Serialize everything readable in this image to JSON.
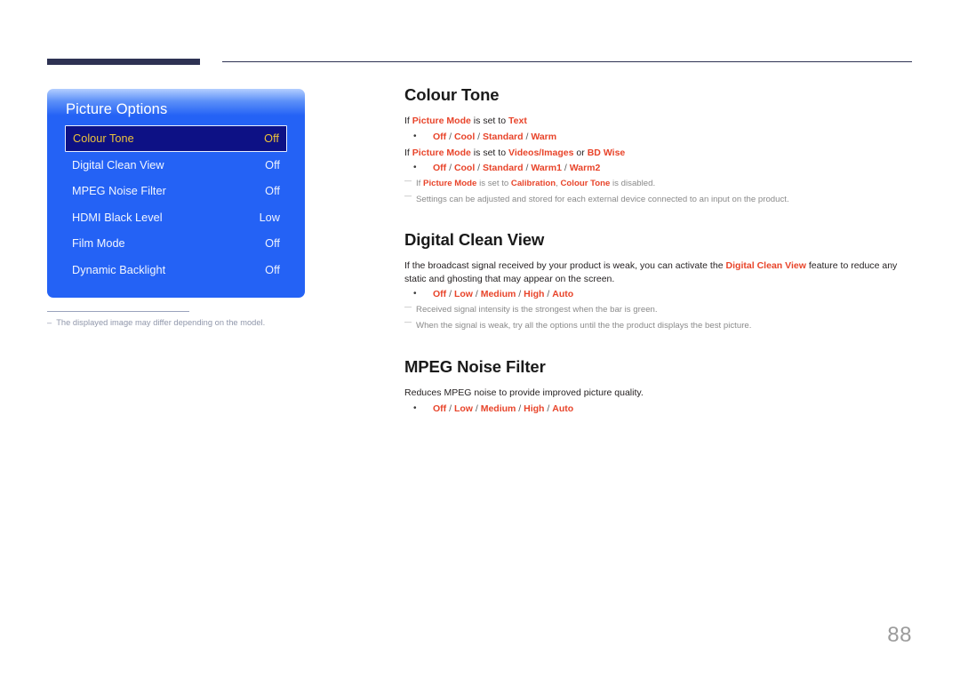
{
  "page": {
    "number": "88",
    "accent_red": "#e8442a",
    "osd_blue": "#2462f5",
    "osd_selected_bg": "#0d1185",
    "osd_selected_text": "#edc23b",
    "header_rule_color": "#2e3253"
  },
  "osd": {
    "title": "Picture Options",
    "rows": [
      {
        "label": "Colour Tone",
        "value": "Off",
        "selected": true
      },
      {
        "label": "Digital Clean View",
        "value": "Off",
        "selected": false
      },
      {
        "label": "MPEG Noise Filter",
        "value": "Off",
        "selected": false
      },
      {
        "label": "HDMI Black Level",
        "value": "Low",
        "selected": false
      },
      {
        "label": "Film Mode",
        "value": "Off",
        "selected": false
      },
      {
        "label": "Dynamic Backlight",
        "value": "Off",
        "selected": false
      }
    ],
    "footnote_dash": "–",
    "footnote": "The displayed image may differ depending on the model."
  },
  "sections": {
    "colour_tone": {
      "heading": "Colour Tone",
      "line1_pre": "If ",
      "line1_term": "Picture Mode",
      "line1_mid": " is set to ",
      "line1_value": "Text",
      "opts1": {
        "o1": "Off",
        "s1": " / ",
        "o2": "Cool",
        "s2": " / ",
        "o3": "Standard",
        "s3": " / ",
        "o4": "Warm"
      },
      "line2_pre": "If ",
      "line2_term": "Picture Mode",
      "line2_mid": " is set to ",
      "line2_value1": "Videos/Images",
      "line2_or": " or ",
      "line2_value2": "BD Wise",
      "opts2": {
        "o1": "Off",
        "s1": " / ",
        "o2": "Cool",
        "s2": " / ",
        "o3": "Standard",
        "s3": " / ",
        "o4": "Warm1",
        "s4": " / ",
        "o5": "Warm2"
      },
      "note1_pre": "If ",
      "note1_term1": "Picture Mode",
      "note1_mid1": " is set to ",
      "note1_term2": "Calibration",
      "note1_mid2": ", ",
      "note1_term3": "Colour Tone",
      "note1_tail": " is disabled.",
      "note2": "Settings can be adjusted and stored for each external device connected to an input on the product."
    },
    "digital_clean_view": {
      "heading": "Digital Clean View",
      "para_pre": "If the broadcast signal received by your product is weak, you can activate the ",
      "para_term": "Digital Clean View",
      "para_post": " feature to reduce any static and ghosting that may appear on the screen.",
      "opts": {
        "o1": "Off",
        "s1": " / ",
        "o2": "Low",
        "s2": " / ",
        "o3": "Medium",
        "s3": " / ",
        "o4": "High",
        "s4": " / ",
        "o5": "Auto"
      },
      "note1": "Received signal intensity is the strongest when the bar is green.",
      "note2": "When the signal is weak, try all the options until the the product displays the best picture."
    },
    "mpeg_noise_filter": {
      "heading": "MPEG Noise Filter",
      "para": "Reduces MPEG noise to provide improved picture quality.",
      "opts": {
        "o1": "Off",
        "s1": " / ",
        "o2": "Low",
        "s2": " / ",
        "o3": "Medium",
        "s3": " / ",
        "o4": "High",
        "s4": " / ",
        "o5": "Auto"
      }
    }
  }
}
